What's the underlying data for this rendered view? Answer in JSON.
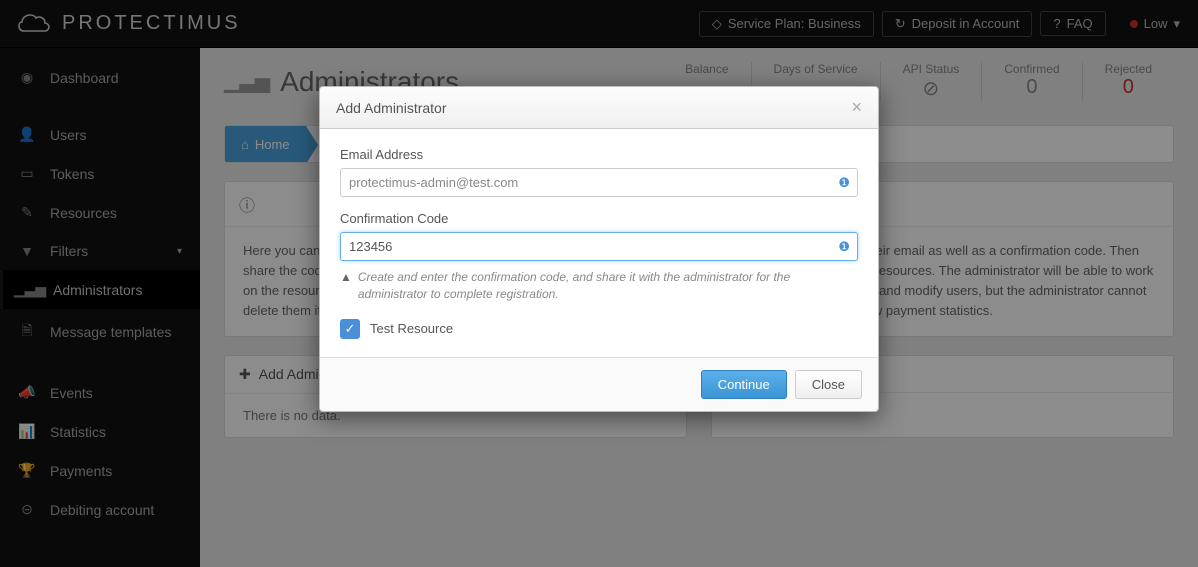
{
  "brand": "PROTECTIMUS",
  "topbar": {
    "service_plan": "Service Plan: Business",
    "deposit": "Deposit in Account",
    "faq": "FAQ",
    "profile": "Low"
  },
  "sidebar": {
    "items": [
      {
        "icon": "dashboard-icon",
        "label": "Dashboard"
      },
      {
        "icon": "user-icon",
        "label": "Users"
      },
      {
        "icon": "tablet-icon",
        "label": "Tokens"
      },
      {
        "icon": "edit-icon",
        "label": "Resources"
      },
      {
        "icon": "filter-icon",
        "label": "Filters"
      },
      {
        "icon": "bars-icon",
        "label": "Administrators"
      },
      {
        "icon": "file-icon",
        "label": "Message templates"
      },
      {
        "icon": "bullhorn-icon",
        "label": "Events"
      },
      {
        "icon": "chart-icon",
        "label": "Statistics"
      },
      {
        "icon": "trophy-icon",
        "label": "Payments"
      },
      {
        "icon": "money-icon",
        "label": "Debiting account"
      }
    ],
    "active_index": 5
  },
  "page": {
    "title": "Administrators",
    "stats": [
      {
        "label": "Balance",
        "value": ""
      },
      {
        "label": "Days of Service",
        "value": ""
      },
      {
        "label": "API Status",
        "value": "⊘",
        "kind": "forbid"
      },
      {
        "label": "Confirmed",
        "value": "0"
      },
      {
        "label": "Rejected",
        "value": "0",
        "kind": "red"
      }
    ],
    "breadcrumb_home": "Home",
    "info_text": "Here you can add administrators who can work on the resources you specify. To add an administrator, enter their email as well as a confirmation code. Then share the code to your administrator so the administrator can complete the registration and begin work on the resources. The administrator will be able to work on the resources you specify, but only you can manage administrators. The administrator will be able to create and modify users, but the administrator cannot delete them if they were not created by that administrator. The administrator cannot use your account, and view payment statistics.",
    "add_panel": "Add Administrator",
    "no_data": "There is no data."
  },
  "modal": {
    "title": "Add Administrator",
    "email_label": "Email Address",
    "email_value": "protectimus-admin@test.com",
    "code_label": "Confirmation Code",
    "code_value": "123456",
    "hint": "Create and enter the confirmation code, and share it with the administrator for the administrator to complete registration.",
    "resource_label": "Test Resource",
    "continue": "Continue",
    "close": "Close"
  }
}
